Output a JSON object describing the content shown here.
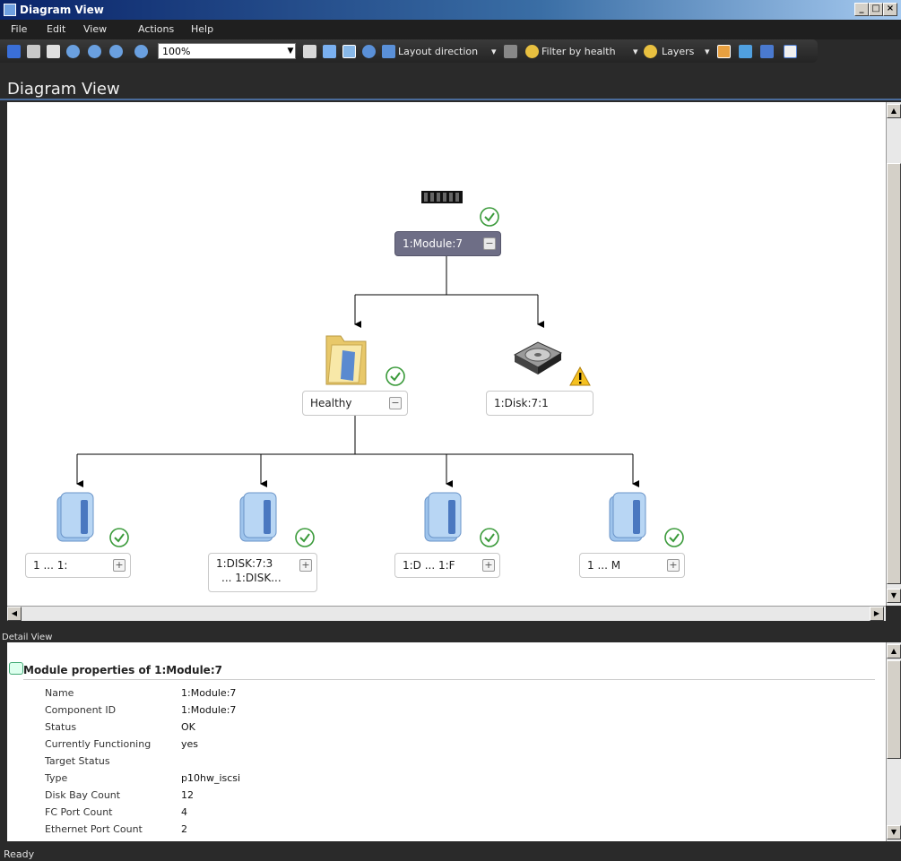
{
  "window": {
    "title": "Diagram View"
  },
  "menu": [
    "File",
    "Edit",
    "View",
    "Actions",
    "Help"
  ],
  "toolbar": {
    "zoom": "100%",
    "layout_direction": "Layout direction",
    "filter_by_health": "Filter by health",
    "layers": "Layers"
  },
  "diagram": {
    "header": "Diagram View",
    "root": {
      "label": "1:Module:7",
      "status": "ok"
    },
    "level1": [
      {
        "label": "Healthy",
        "status": "ok"
      },
      {
        "label": "1:Disk:7:1",
        "status": "warning"
      }
    ],
    "level2": [
      {
        "label": "1 ... 1:",
        "status": "ok"
      },
      {
        "label_line1": "1:DISK:7:3",
        "label_line2": "... 1:DISK...",
        "status": "ok"
      },
      {
        "label": "1:D ... 1:F",
        "status": "ok"
      },
      {
        "label": "1 ... M",
        "status": "ok"
      }
    ]
  },
  "detail": {
    "header": "Detail View",
    "title": "Module properties of 1:Module:7",
    "properties": [
      {
        "name": "Name",
        "value": "1:Module:7"
      },
      {
        "name": "Component ID",
        "value": "1:Module:7"
      },
      {
        "name": "Status",
        "value": "OK"
      },
      {
        "name": "Currently Functioning",
        "value": "yes"
      },
      {
        "name": "Target Status",
        "value": ""
      },
      {
        "name": "Type",
        "value": "p10hw_iscsi"
      },
      {
        "name": "Disk Bay Count",
        "value": "12"
      },
      {
        "name": "FC Port Count",
        "value": "4"
      },
      {
        "name": "Ethernet Port Count",
        "value": "2"
      }
    ]
  },
  "statusbar": {
    "text": "Ready"
  }
}
